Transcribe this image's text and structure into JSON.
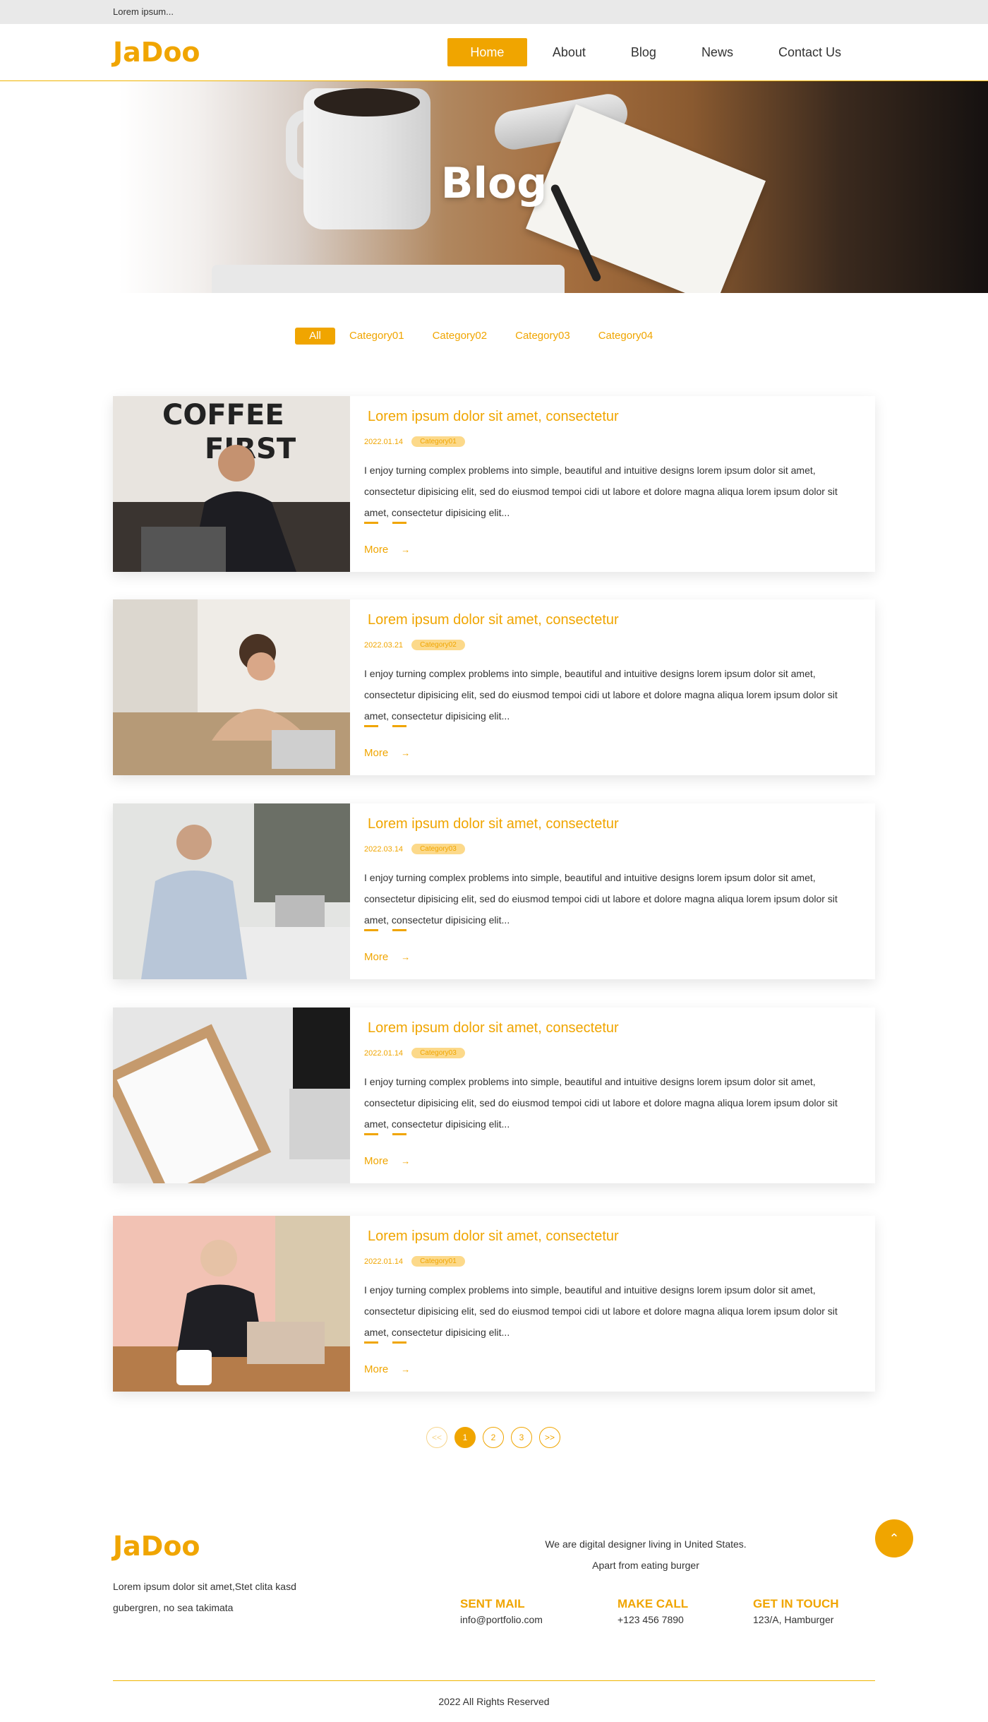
{
  "topbar": {
    "text": "Lorem ipsum..."
  },
  "header": {
    "logo": "JaDoo",
    "nav": [
      {
        "label": "Home",
        "active": true
      },
      {
        "label": "About"
      },
      {
        "label": "Blog"
      },
      {
        "label": "News"
      },
      {
        "label": "Contact Us"
      }
    ]
  },
  "hero": {
    "title": "Blog"
  },
  "filters": [
    "All",
    "Category01",
    "Category02",
    "Category03",
    "Category04"
  ],
  "posts": [
    {
      "title": "Lorem ipsum dolor sit amet, consectetur",
      "date": "2022.01.14",
      "category": "Category01",
      "excerpt": "I enjoy turning complex problems into simple, beautiful and intuitive designs lorem ipsum dolor sit amet, consectetur dipisicing elit, sed do eiusmod tempoi cidi ut labore et dolore magna aliqua lorem ipsum dolor sit amet, consectetur dipisicing elit...",
      "more": "More"
    },
    {
      "title": "Lorem ipsum dolor sit amet, consectetur",
      "date": "2022.03.21",
      "category": "Category02",
      "excerpt": "I enjoy turning complex problems into simple, beautiful and intuitive designs lorem ipsum dolor sit amet, consectetur dipisicing elit, sed do eiusmod tempoi cidi ut labore et dolore magna aliqua lorem ipsum dolor sit amet, consectetur dipisicing elit...",
      "more": "More"
    },
    {
      "title": "Lorem ipsum dolor sit amet, consectetur",
      "date": "2022.03.14",
      "category": "Category03",
      "excerpt": "I enjoy turning complex problems into simple, beautiful and intuitive designs lorem ipsum dolor sit amet, consectetur dipisicing elit, sed do eiusmod tempoi cidi ut labore et dolore magna aliqua lorem ipsum dolor sit amet, consectetur dipisicing elit...",
      "more": "More"
    },
    {
      "title": "Lorem ipsum dolor sit amet, consectetur",
      "date": "2022.01.14",
      "category": "Category03",
      "excerpt": "I enjoy turning complex problems into simple, beautiful and intuitive designs lorem ipsum dolor sit amet, consectetur dipisicing elit, sed do eiusmod tempoi cidi ut labore et dolore magna aliqua lorem ipsum dolor sit amet, consectetur dipisicing elit...",
      "more": "More"
    },
    {
      "title": "Lorem ipsum dolor sit amet, consectetur",
      "date": "2022.01.14",
      "category": "Category01",
      "excerpt": "I enjoy turning complex problems into simple, beautiful and intuitive designs lorem ipsum dolor sit amet, consectetur dipisicing elit, sed do eiusmod tempoi cidi ut labore et dolore magna aliqua lorem ipsum dolor sit amet, consectetur dipisicing elit...",
      "more": "More"
    }
  ],
  "pagination": {
    "prev": "<<",
    "pages": [
      "1",
      "2",
      "3"
    ],
    "current": "1",
    "next": ">>"
  },
  "footer": {
    "logo": "JaDoo",
    "description": "Lorem ipsum dolor sit amet,Stet clita kasd gubergren, no sea takimata",
    "tagline_1": "We are digital designer living in United States.",
    "tagline_2": "Apart from eating burger",
    "contacts": [
      {
        "title": "SENT MAIL",
        "value": "info@portfolio.com"
      },
      {
        "title": "MAKE CALL",
        "value": "+123 456 7890"
      },
      {
        "title": "GET IN TOUCH",
        "value": "123/A, Hamburger"
      }
    ],
    "copyright": "2022 All Rights Reserved"
  },
  "icons": {
    "back_to_top": "chevron-up-icon",
    "more_arrow": "arrow-right-icon"
  },
  "colors": {
    "accent": "#f0a500",
    "category_badge": "#fcd98a"
  }
}
